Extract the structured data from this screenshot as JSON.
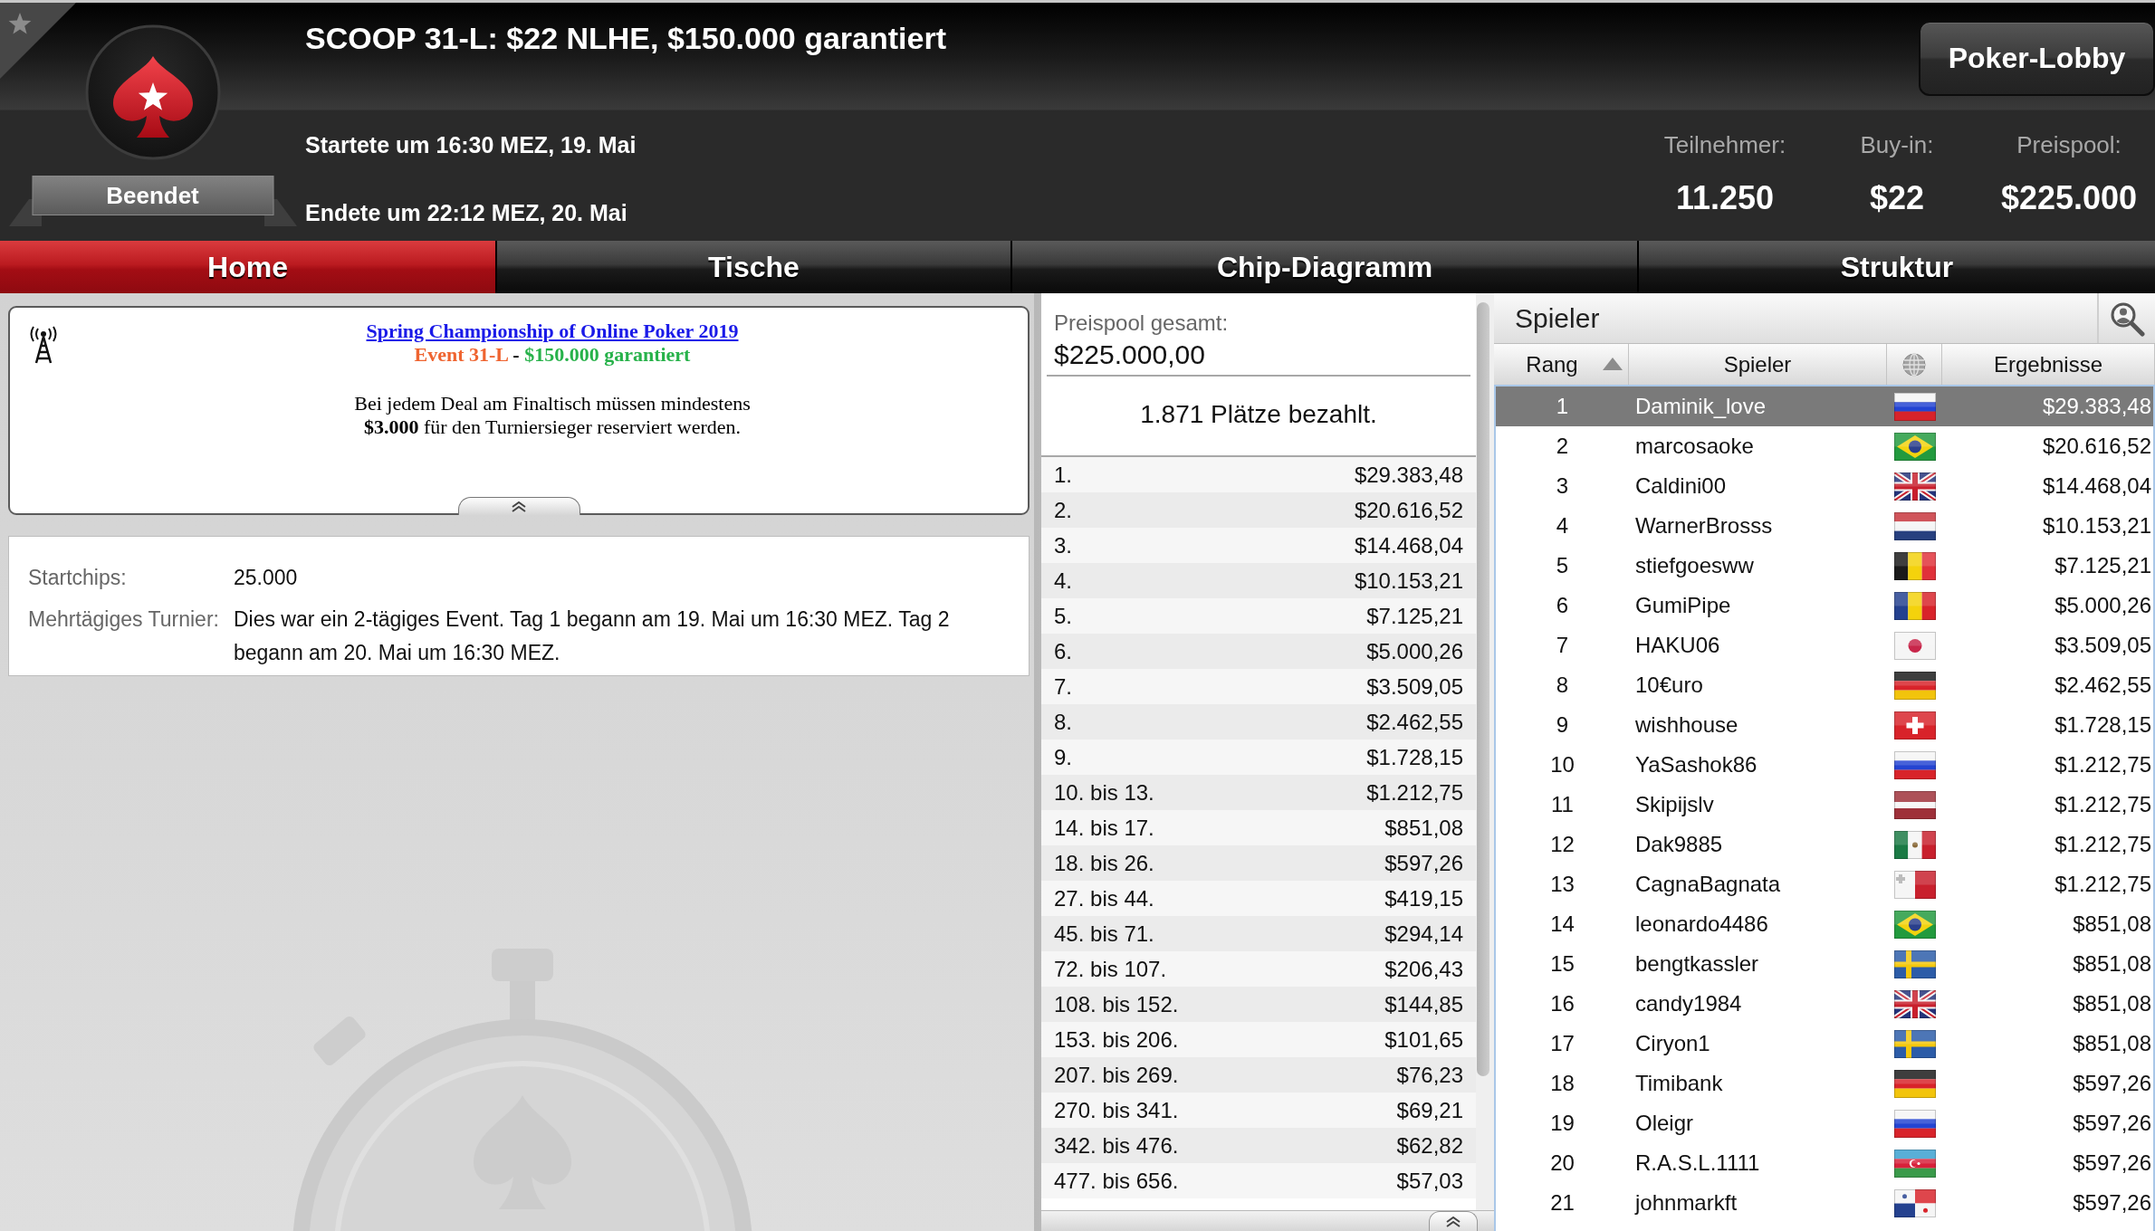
{
  "header": {
    "status": "Beendet",
    "title": "SCOOP 31-L: $22 NLHE, $150.000 garantiert",
    "started": "Startete um 16:30 MEZ, 19. Mai",
    "ended": "Endete um 22:12 MEZ, 20. Mai",
    "lobby_button": "Poker-Lobby",
    "stats": [
      {
        "label": "Teilnehmer:",
        "value": "11.250"
      },
      {
        "label": "Buy-in:",
        "value": "$22"
      },
      {
        "label": "Preispool:",
        "value": "$225.000"
      }
    ]
  },
  "tabs": [
    {
      "label": "Home",
      "selected": true
    },
    {
      "label": "Tische",
      "selected": false
    },
    {
      "label": "Chip-Diagramm",
      "selected": false
    },
    {
      "label": "Struktur",
      "selected": false
    }
  ],
  "announcement": {
    "link": "Spring Championship of Online Poker 2019",
    "subtitle": [
      {
        "text": "Event 31-L",
        "color": "#ef6430"
      },
      {
        "text": "-",
        "color": "#000000"
      },
      {
        "text": "$150.000 garantiert",
        "color": "#27b24a"
      }
    ],
    "message": "Bei jedem Deal am Finaltisch müssen mindestens\n**$3.000** für den Turniersieger reserviert werden."
  },
  "details": [
    {
      "label": "Startchips:",
      "value": "25.000"
    },
    {
      "label": "Mehrtägiges Turnier:",
      "value": "Dies war ein 2-tägiges Event. Tag 1 begann am 19. Mai um 16:30 MEZ. Tag 2 begann am 20. Mai um 16:30 MEZ."
    }
  ],
  "prize_pool": {
    "label": "Preispool gesamt:",
    "total": "$225.000,00",
    "paid_places": "1.871 Plätze bezahlt.",
    "payouts": [
      {
        "place": "1.",
        "amount": "$29.383,48"
      },
      {
        "place": "2.",
        "amount": "$20.616,52"
      },
      {
        "place": "3.",
        "amount": "$14.468,04"
      },
      {
        "place": "4.",
        "amount": "$10.153,21"
      },
      {
        "place": "5.",
        "amount": "$7.125,21"
      },
      {
        "place": "6.",
        "amount": "$5.000,26"
      },
      {
        "place": "7.",
        "amount": "$3.509,05"
      },
      {
        "place": "8.",
        "amount": "$2.462,55"
      },
      {
        "place": "9.",
        "amount": "$1.728,15"
      },
      {
        "place": "10. bis 13.",
        "amount": "$1.212,75"
      },
      {
        "place": "14. bis 17.",
        "amount": "$851,08"
      },
      {
        "place": "18. bis 26.",
        "amount": "$597,26"
      },
      {
        "place": "27. bis 44.",
        "amount": "$419,15"
      },
      {
        "place": "45. bis 71.",
        "amount": "$294,14"
      },
      {
        "place": "72. bis 107.",
        "amount": "$206,43"
      },
      {
        "place": "108. bis 152.",
        "amount": "$144,85"
      },
      {
        "place": "153. bis 206.",
        "amount": "$101,65"
      },
      {
        "place": "207. bis 269.",
        "amount": "$76,23"
      },
      {
        "place": "270. bis 341.",
        "amount": "$69,21"
      },
      {
        "place": "342. bis 476.",
        "amount": "$62,82"
      },
      {
        "place": "477. bis 656.",
        "amount": "$57,03"
      }
    ]
  },
  "players": {
    "title": "Spieler",
    "columns": [
      {
        "kind": "text",
        "label": "Rang",
        "sorted": true
      },
      {
        "kind": "text",
        "label": "Spieler",
        "sorted": false
      },
      {
        "kind": "globe",
        "sorted": false
      },
      {
        "kind": "text",
        "label": "Ergebnisse",
        "sorted": false
      }
    ],
    "rows": [
      {
        "rank": "1",
        "name": "Daminik_love",
        "flag": {
          "kind": "russia"
        },
        "winnings": "$29.383,48",
        "selected": true
      },
      {
        "rank": "2",
        "name": "marcosaoke",
        "flag": {
          "kind": "brazil"
        },
        "winnings": "$20.616,52",
        "selected": false
      },
      {
        "rank": "3",
        "name": "Caldini00",
        "flag": {
          "kind": "uk"
        },
        "winnings": "$14.468,04",
        "selected": false
      },
      {
        "rank": "4",
        "name": "WarnerBrosss",
        "flag": {
          "kind": "netherlands"
        },
        "winnings": "$10.153,21",
        "selected": false
      },
      {
        "rank": "5",
        "name": "stiefgoesww",
        "flag": {
          "kind": "belgium"
        },
        "winnings": "$7.125,21",
        "selected": false
      },
      {
        "rank": "6",
        "name": "GumiPipe",
        "flag": {
          "kind": "romania"
        },
        "winnings": "$5.000,26",
        "selected": false
      },
      {
        "rank": "7",
        "name": "HAKU06",
        "flag": {
          "kind": "japan"
        },
        "winnings": "$3.509,05",
        "selected": false
      },
      {
        "rank": "8",
        "name": "10€uro",
        "flag": {
          "kind": "germany"
        },
        "winnings": "$2.462,55",
        "selected": false
      },
      {
        "rank": "9",
        "name": "wishhouse",
        "flag": {
          "kind": "switzerland"
        },
        "winnings": "$1.728,15",
        "selected": false
      },
      {
        "rank": "10",
        "name": "YaSashok86",
        "flag": {
          "kind": "russia"
        },
        "winnings": "$1.212,75",
        "selected": false
      },
      {
        "rank": "11",
        "name": "Skipijslv",
        "flag": {
          "kind": "latvia"
        },
        "winnings": "$1.212,75",
        "selected": false
      },
      {
        "rank": "12",
        "name": "Dak9885",
        "flag": {
          "kind": "mexico"
        },
        "winnings": "$1.212,75",
        "selected": false
      },
      {
        "rank": "13",
        "name": "CagnaBagnata",
        "flag": {
          "kind": "malta"
        },
        "winnings": "$1.212,75",
        "selected": false
      },
      {
        "rank": "14",
        "name": "leonardo4486",
        "flag": {
          "kind": "brazil"
        },
        "winnings": "$851,08",
        "selected": false
      },
      {
        "rank": "15",
        "name": "bengtkassler",
        "flag": {
          "kind": "sweden"
        },
        "winnings": "$851,08",
        "selected": false
      },
      {
        "rank": "16",
        "name": "candy1984",
        "flag": {
          "kind": "uk"
        },
        "winnings": "$851,08",
        "selected": false
      },
      {
        "rank": "17",
        "name": "Ciryon1",
        "flag": {
          "kind": "sweden"
        },
        "winnings": "$851,08",
        "selected": false
      },
      {
        "rank": "18",
        "name": "Timibank",
        "flag": {
          "kind": "germany"
        },
        "winnings": "$597,26",
        "selected": false
      },
      {
        "rank": "19",
        "name": "Oleigr",
        "flag": {
          "kind": "russia"
        },
        "winnings": "$597,26",
        "selected": false
      },
      {
        "rank": "20",
        "name": "R.A.S.L.1111",
        "flag": {
          "kind": "azerbaijan"
        },
        "winnings": "$597,26",
        "selected": false
      },
      {
        "rank": "21",
        "name": "johnmarkft",
        "flag": {
          "kind": "panama"
        },
        "winnings": "$597,26",
        "selected": false
      }
    ]
  }
}
